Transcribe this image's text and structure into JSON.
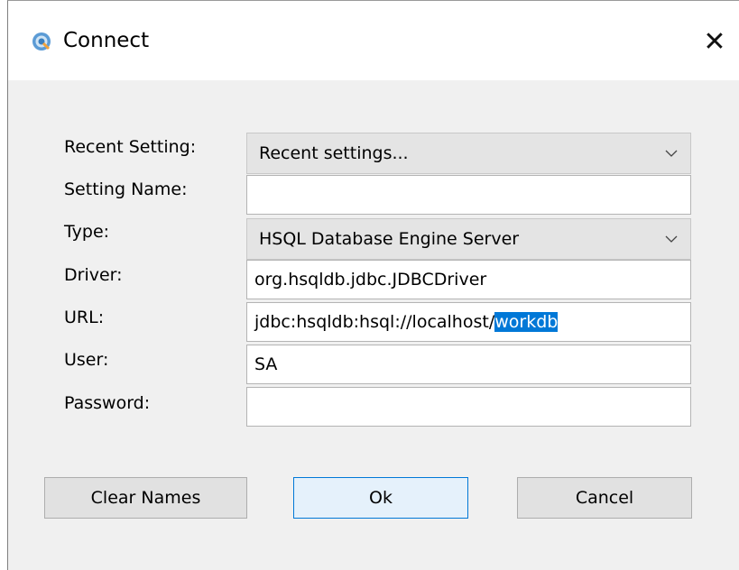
{
  "window": {
    "title": "Connect",
    "close_glyph": "✕"
  },
  "form": {
    "recent_setting": {
      "label": "Recent Setting:",
      "value": "Recent settings..."
    },
    "setting_name": {
      "label": "Setting Name:",
      "value": ""
    },
    "type": {
      "label": "Type:",
      "value": "HSQL Database Engine Server"
    },
    "driver": {
      "label": "Driver:",
      "value": "org.hsqldb.jdbc.JDBCDriver"
    },
    "url": {
      "label": "URL:",
      "value_prefix": "jdbc:hsqldb:hsql://localhost/",
      "value_selected": "workdb"
    },
    "user": {
      "label": "User:",
      "value": "SA"
    },
    "password": {
      "label": "Password:",
      "value": ""
    }
  },
  "buttons": {
    "clear_names": "Clear Names",
    "ok": "Ok",
    "cancel": "Cancel"
  },
  "colors": {
    "selection": "#0078d7",
    "app_icon": "#4a90c8"
  },
  "icons": {
    "app": "hsqldb-app-icon",
    "close": "close-icon",
    "dropdown": "chevron-down-icon"
  }
}
